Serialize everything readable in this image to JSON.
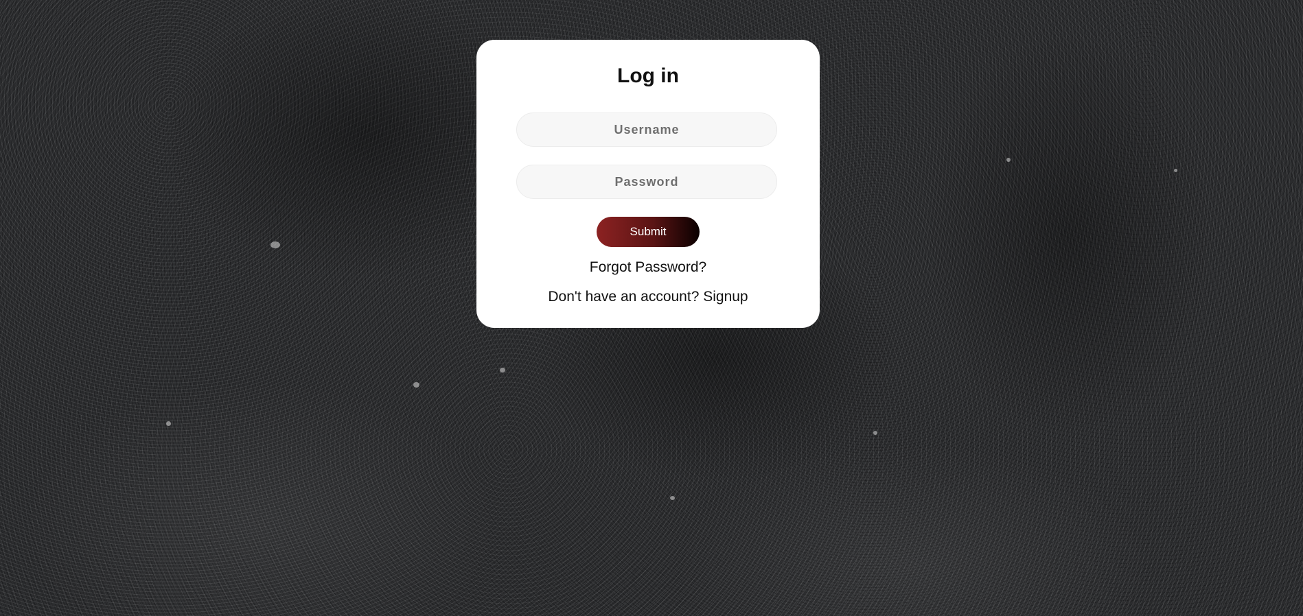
{
  "login": {
    "title": "Log in",
    "username_placeholder": "Username",
    "username_value": "",
    "password_placeholder": "Password",
    "password_value": "",
    "submit_label": "Submit",
    "forgot_password_label": "Forgot Password?",
    "signup_prompt": "Don't have an account?",
    "signup_label": "Signup"
  },
  "colors": {
    "card_background": "#ffffff",
    "submit_gradient_start": "#8c2222",
    "submit_gradient_end": "#0a0000",
    "background": "#2b2c2e"
  }
}
